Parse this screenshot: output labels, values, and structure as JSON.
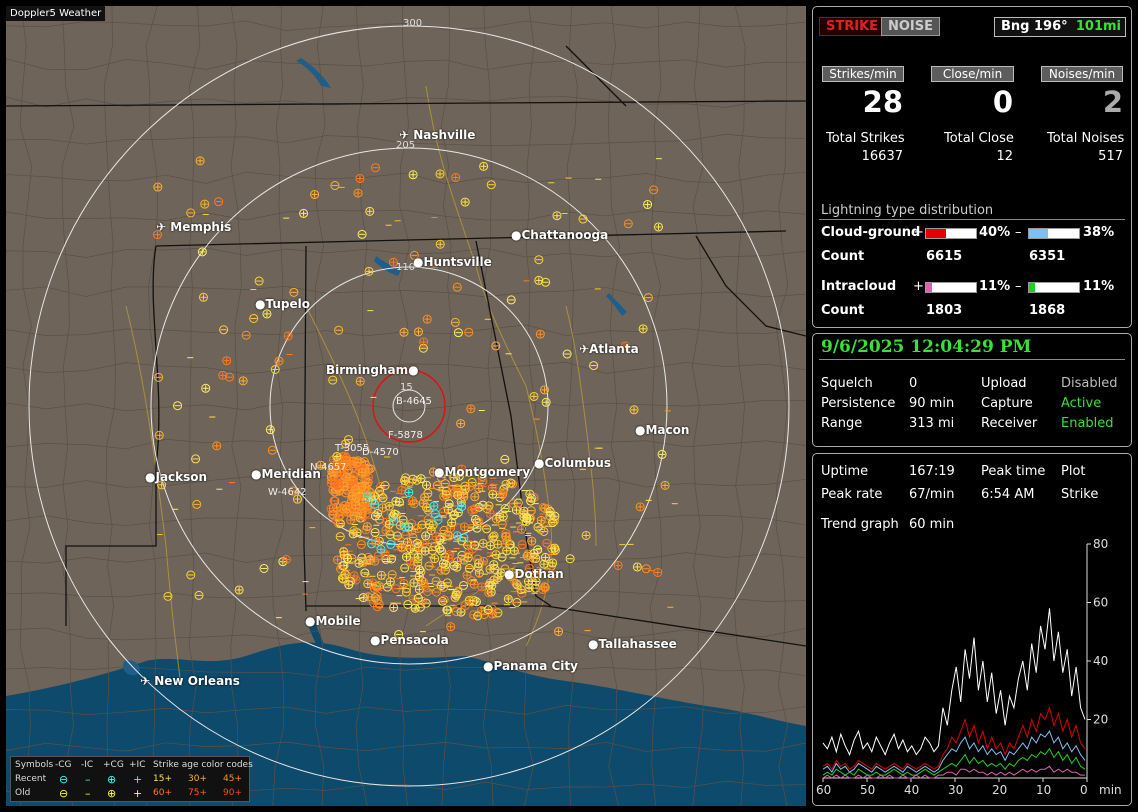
{
  "app": {
    "title": "Doppler5 Weather"
  },
  "map": {
    "range_labels": [
      "300",
      "205",
      "110",
      "15"
    ],
    "cities": [
      {
        "name": "Nashville",
        "airport": true
      },
      {
        "name": "Memphis",
        "airport": true
      },
      {
        "name": "Chattanooga",
        "airport": false
      },
      {
        "name": "Huntsville",
        "airport": false
      },
      {
        "name": "Tupelo",
        "airport": false
      },
      {
        "name": "Atlanta",
        "airport": true
      },
      {
        "name": "Birmingham",
        "airport": false
      },
      {
        "name": "Macon",
        "airport": false
      },
      {
        "name": "Jackson",
        "airport": false
      },
      {
        "name": "Meridian",
        "airport": false
      },
      {
        "name": "Montgomery",
        "airport": false
      },
      {
        "name": "Columbus",
        "airport": false
      },
      {
        "name": "Dothan",
        "airport": false
      },
      {
        "name": "Mobile",
        "airport": false
      },
      {
        "name": "Pensacola",
        "airport": false
      },
      {
        "name": "Tallahassee",
        "airport": false
      },
      {
        "name": "Panama City",
        "airport": false
      },
      {
        "name": "New Orleans",
        "airport": true
      }
    ],
    "storm_labels": [
      "B-4645",
      "F-5878",
      "T-3055",
      "D-4570",
      "N-4657",
      "W-4642"
    ]
  },
  "legend": {
    "symbols_label": "Symbols",
    "types": [
      "-CG",
      "-IC",
      "+CG",
      "+IC"
    ],
    "recent_label": "Recent",
    "old_label": "Old",
    "age_title": "Strike age color codes",
    "recent_ages": [
      "15+",
      "30+",
      "45+"
    ],
    "old_ages": [
      "60+",
      "75+",
      "90+"
    ]
  },
  "status": {
    "strike_label": "STRIKE",
    "noise_label": "NOISE",
    "bearing": "Bng 196°",
    "distance": "101mi",
    "strikes_per_min_label": "Strikes/min",
    "close_per_min_label": "Close/min",
    "noises_per_min_label": "Noises/min",
    "strikes_per_min": "28",
    "close_per_min": "0",
    "noises_per_min": "2",
    "total_strikes_label": "Total Strikes",
    "total_close_label": "Total Close",
    "total_noises_label": "Total Noises",
    "total_strikes": "16637",
    "total_close": "12",
    "total_noises": "517"
  },
  "distribution": {
    "title": "Lightning type distribution",
    "cg_label": "Cloud-ground",
    "ic_label": "Intracloud",
    "count_label": "Count",
    "plus_sign": "+",
    "minus_sign": "–",
    "cg_pos_pct": "40%",
    "cg_pos_value": 40,
    "cg_neg_pct": "38%",
    "cg_neg_value": 38,
    "cg_pos_count": "6615",
    "cg_neg_count": "6351",
    "ic_pos_pct": "11%",
    "ic_pos_value": 11,
    "ic_neg_pct": "11%",
    "ic_neg_value": 11,
    "ic_pos_count": "1803",
    "ic_neg_count": "1868",
    "colors": {
      "cg_pos": "#e00000",
      "cg_neg": "#80c0f0",
      "ic_pos": "#e060b0",
      "ic_neg": "#20d020"
    }
  },
  "settings": {
    "datetime": "9/6/2025 12:04:29 PM",
    "squelch_label": "Squelch",
    "squelch": "0",
    "persistence_label": "Persistence",
    "persistence": "90 min",
    "range_label": "Range",
    "range": "313 mi",
    "upload_label": "Upload",
    "upload": "Disabled",
    "capture_label": "Capture",
    "capture": "Active",
    "receiver_label": "Receiver",
    "receiver": "Enabled"
  },
  "stats": {
    "uptime_label": "Uptime",
    "uptime": "167:19",
    "peak_time_label": "Peak time",
    "peak_time": "6:54 AM",
    "plot_label": "Plot",
    "plot_value": "Strike",
    "peak_rate_label": "Peak rate",
    "peak_rate": "67/min",
    "trend_label": "Trend graph",
    "trend_value": "60 min"
  },
  "chart_data": {
    "type": "line",
    "title": "",
    "x_ticks": [
      "60",
      "50",
      "40",
      "30",
      "20",
      "10",
      "0"
    ],
    "x_unit": "min",
    "y_ticks": [
      "80",
      "60",
      "40",
      "20"
    ],
    "xlim": [
      60,
      0
    ],
    "ylim": [
      0,
      80
    ],
    "series": [
      {
        "color": "#ffffff",
        "values": [
          12,
          10,
          14,
          9,
          15,
          11,
          8,
          13,
          16,
          10,
          12,
          9,
          14,
          11,
          8,
          12,
          15,
          10,
          13,
          9,
          11,
          8,
          10,
          14,
          12,
          9,
          11,
          24,
          18,
          30,
          38,
          26,
          44,
          34,
          48,
          30,
          40,
          26,
          36,
          22,
          30,
          18,
          28,
          24,
          34,
          40,
          30,
          46,
          36,
          52,
          44,
          58,
          40,
          50,
          36,
          44,
          28,
          38,
          24,
          20
        ]
      },
      {
        "color": "#e00000",
        "values": [
          4,
          5,
          3,
          6,
          4,
          5,
          3,
          4,
          6,
          5,
          4,
          3,
          5,
          4,
          3,
          4,
          5,
          4,
          3,
          5,
          4,
          3,
          4,
          5,
          4,
          3,
          4,
          8,
          10,
          14,
          12,
          16,
          20,
          14,
          18,
          12,
          16,
          10,
          14,
          10,
          12,
          8,
          12,
          10,
          14,
          18,
          14,
          20,
          16,
          22,
          20,
          24,
          18,
          22,
          16,
          20,
          14,
          18,
          12,
          10
        ]
      },
      {
        "color": "#80c0f0",
        "values": [
          3,
          4,
          2,
          5,
          3,
          4,
          2,
          3,
          5,
          4,
          3,
          2,
          4,
          3,
          2,
          3,
          4,
          3,
          2,
          4,
          3,
          2,
          3,
          4,
          3,
          2,
          3,
          6,
          8,
          10,
          9,
          12,
          14,
          10,
          12,
          9,
          11,
          8,
          10,
          8,
          9,
          6,
          9,
          8,
          10,
          12,
          10,
          14,
          12,
          15,
          14,
          16,
          12,
          14,
          10,
          12,
          9,
          11,
          8,
          6
        ]
      },
      {
        "color": "#20d020",
        "values": [
          1,
          2,
          1,
          3,
          2,
          1,
          2,
          1,
          3,
          2,
          1,
          1,
          2,
          1,
          1,
          2,
          3,
          2,
          1,
          2,
          1,
          1,
          2,
          3,
          2,
          1,
          2,
          3,
          4,
          5,
          4,
          6,
          8,
          5,
          7,
          5,
          6,
          4,
          5,
          4,
          5,
          3,
          5,
          4,
          6,
          7,
          6,
          8,
          7,
          9,
          8,
          10,
          7,
          9,
          6,
          8,
          5,
          7,
          4,
          3
        ]
      },
      {
        "color": "#e060b0",
        "values": [
          0,
          1,
          0,
          1,
          0,
          1,
          0,
          0,
          1,
          0,
          1,
          0,
          0,
          1,
          0,
          1,
          0,
          0,
          1,
          0,
          0,
          1,
          0,
          1,
          0,
          0,
          1,
          1,
          2,
          2,
          1,
          3,
          3,
          2,
          3,
          2,
          2,
          1,
          2,
          1,
          2,
          1,
          2,
          1,
          2,
          3,
          2,
          3,
          2,
          3,
          3,
          4,
          2,
          3,
          2,
          3,
          2,
          2,
          1,
          1
        ]
      }
    ]
  }
}
